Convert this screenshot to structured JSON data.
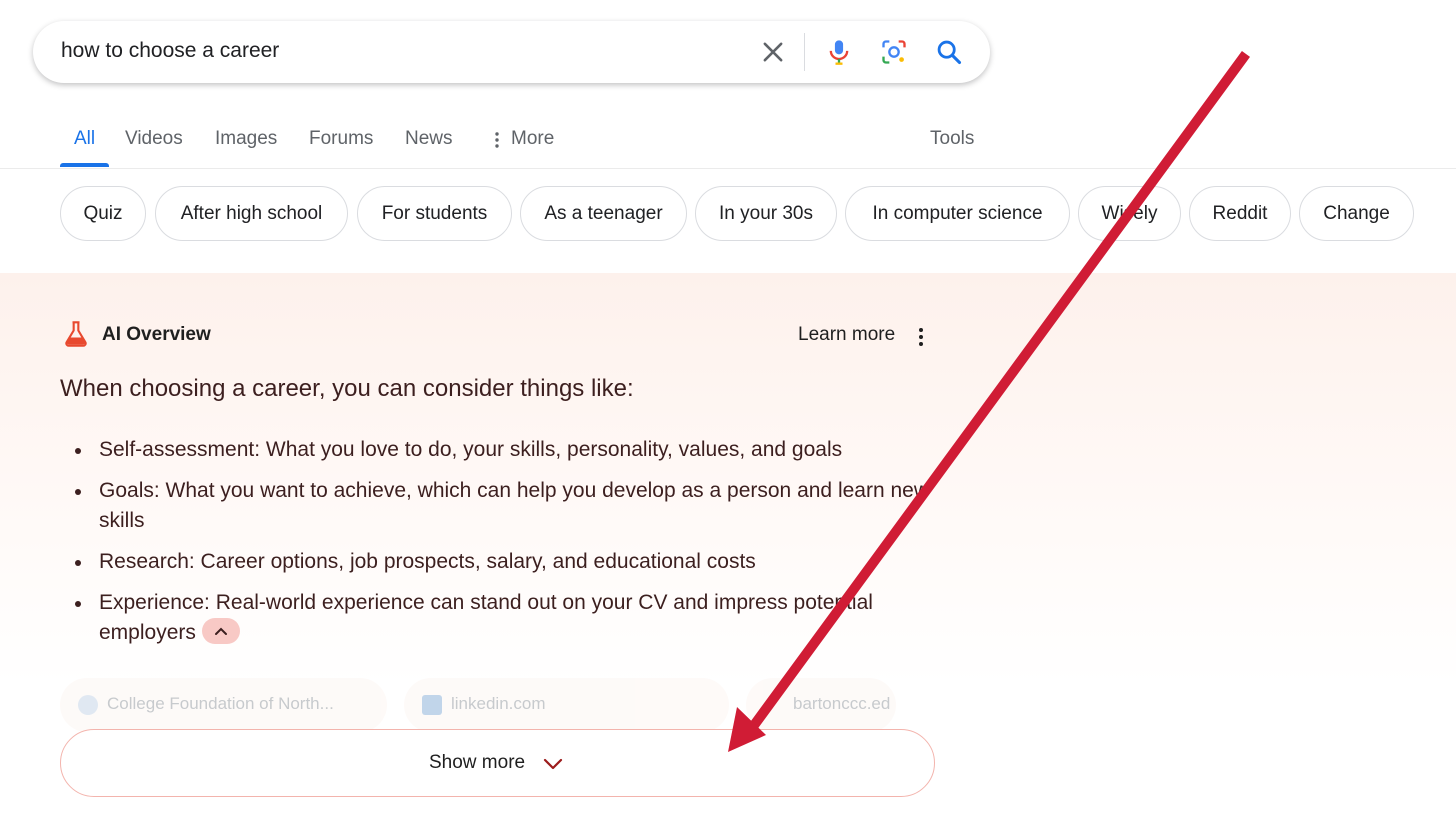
{
  "search": {
    "query": "how to choose a career",
    "clear_icon": "close-icon",
    "voice_icon": "microphone-icon",
    "lens_icon": "camera-lens-icon",
    "search_icon": "search-icon"
  },
  "tabs": [
    {
      "label": "All",
      "active": true
    },
    {
      "label": "Videos"
    },
    {
      "label": "Images"
    },
    {
      "label": "Forums"
    },
    {
      "label": "News"
    },
    {
      "label": "More"
    }
  ],
  "tools_label": "Tools",
  "chips": [
    "Quiz",
    "After high school",
    "For students",
    "As a teenager",
    "In your 30s",
    "In computer science",
    "Wisely",
    "Reddit",
    "Change"
  ],
  "ai_overview": {
    "title": "AI Overview",
    "learn_more": "Learn more",
    "lead": "When choosing a career, you can consider things like:",
    "bullets": [
      "Self-assessment: What you love to do, your skills, personality, values, and goals",
      "Goals: What you want to achieve, which can help you develop as a person and learn new skills",
      "Research: Career options, job prospects, salary, and educational costs",
      "Experience: Real-world experience can stand out on your CV and impress potential employers"
    ],
    "sources": [
      "College Foundation of North...",
      "linkedin.com",
      "bartonccc.ed"
    ],
    "show_more": "Show more"
  },
  "colors": {
    "accent": "#1a73e8",
    "ai_accent": "#e8492f",
    "annotation_arrow": "#d01c35"
  }
}
